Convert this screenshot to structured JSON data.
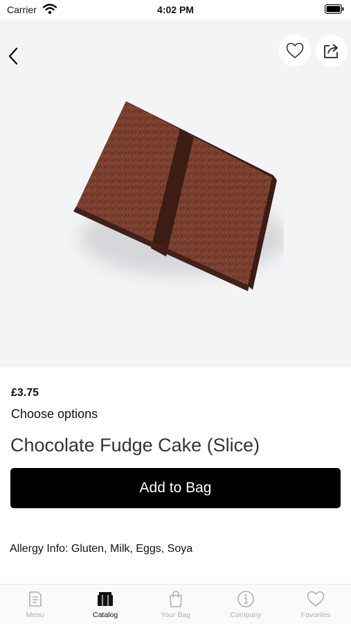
{
  "status_bar": {
    "carrier": "Carrier",
    "time": "4:02 PM"
  },
  "header": {
    "back_icon": "chevron-left-icon",
    "favorite_icon": "heart-icon",
    "share_icon": "share-icon"
  },
  "product": {
    "image": "chocolate-fudge-cake-slice",
    "price": "£3.75",
    "options_label": "Choose options",
    "name": "Chocolate Fudge Cake (Slice)",
    "add_button_label": "Add to Bag",
    "allergy_info": "Allergy Info: Gluten, Milk, Eggs, Soya"
  },
  "tabbar": {
    "items": [
      {
        "label": "Menu",
        "icon": "menu-book-icon",
        "active": false
      },
      {
        "label": "Catalog",
        "icon": "catalog-box-icon",
        "active": true
      },
      {
        "label": "Your Bag",
        "icon": "bag-icon",
        "active": false
      },
      {
        "label": "Company",
        "icon": "info-icon",
        "active": false
      },
      {
        "label": "Favorites",
        "icon": "heart-icon",
        "active": false
      }
    ]
  },
  "colors": {
    "accent": "#000000",
    "hero_background": "#f3f4f6",
    "inactive_tab": "#aab0b8"
  }
}
